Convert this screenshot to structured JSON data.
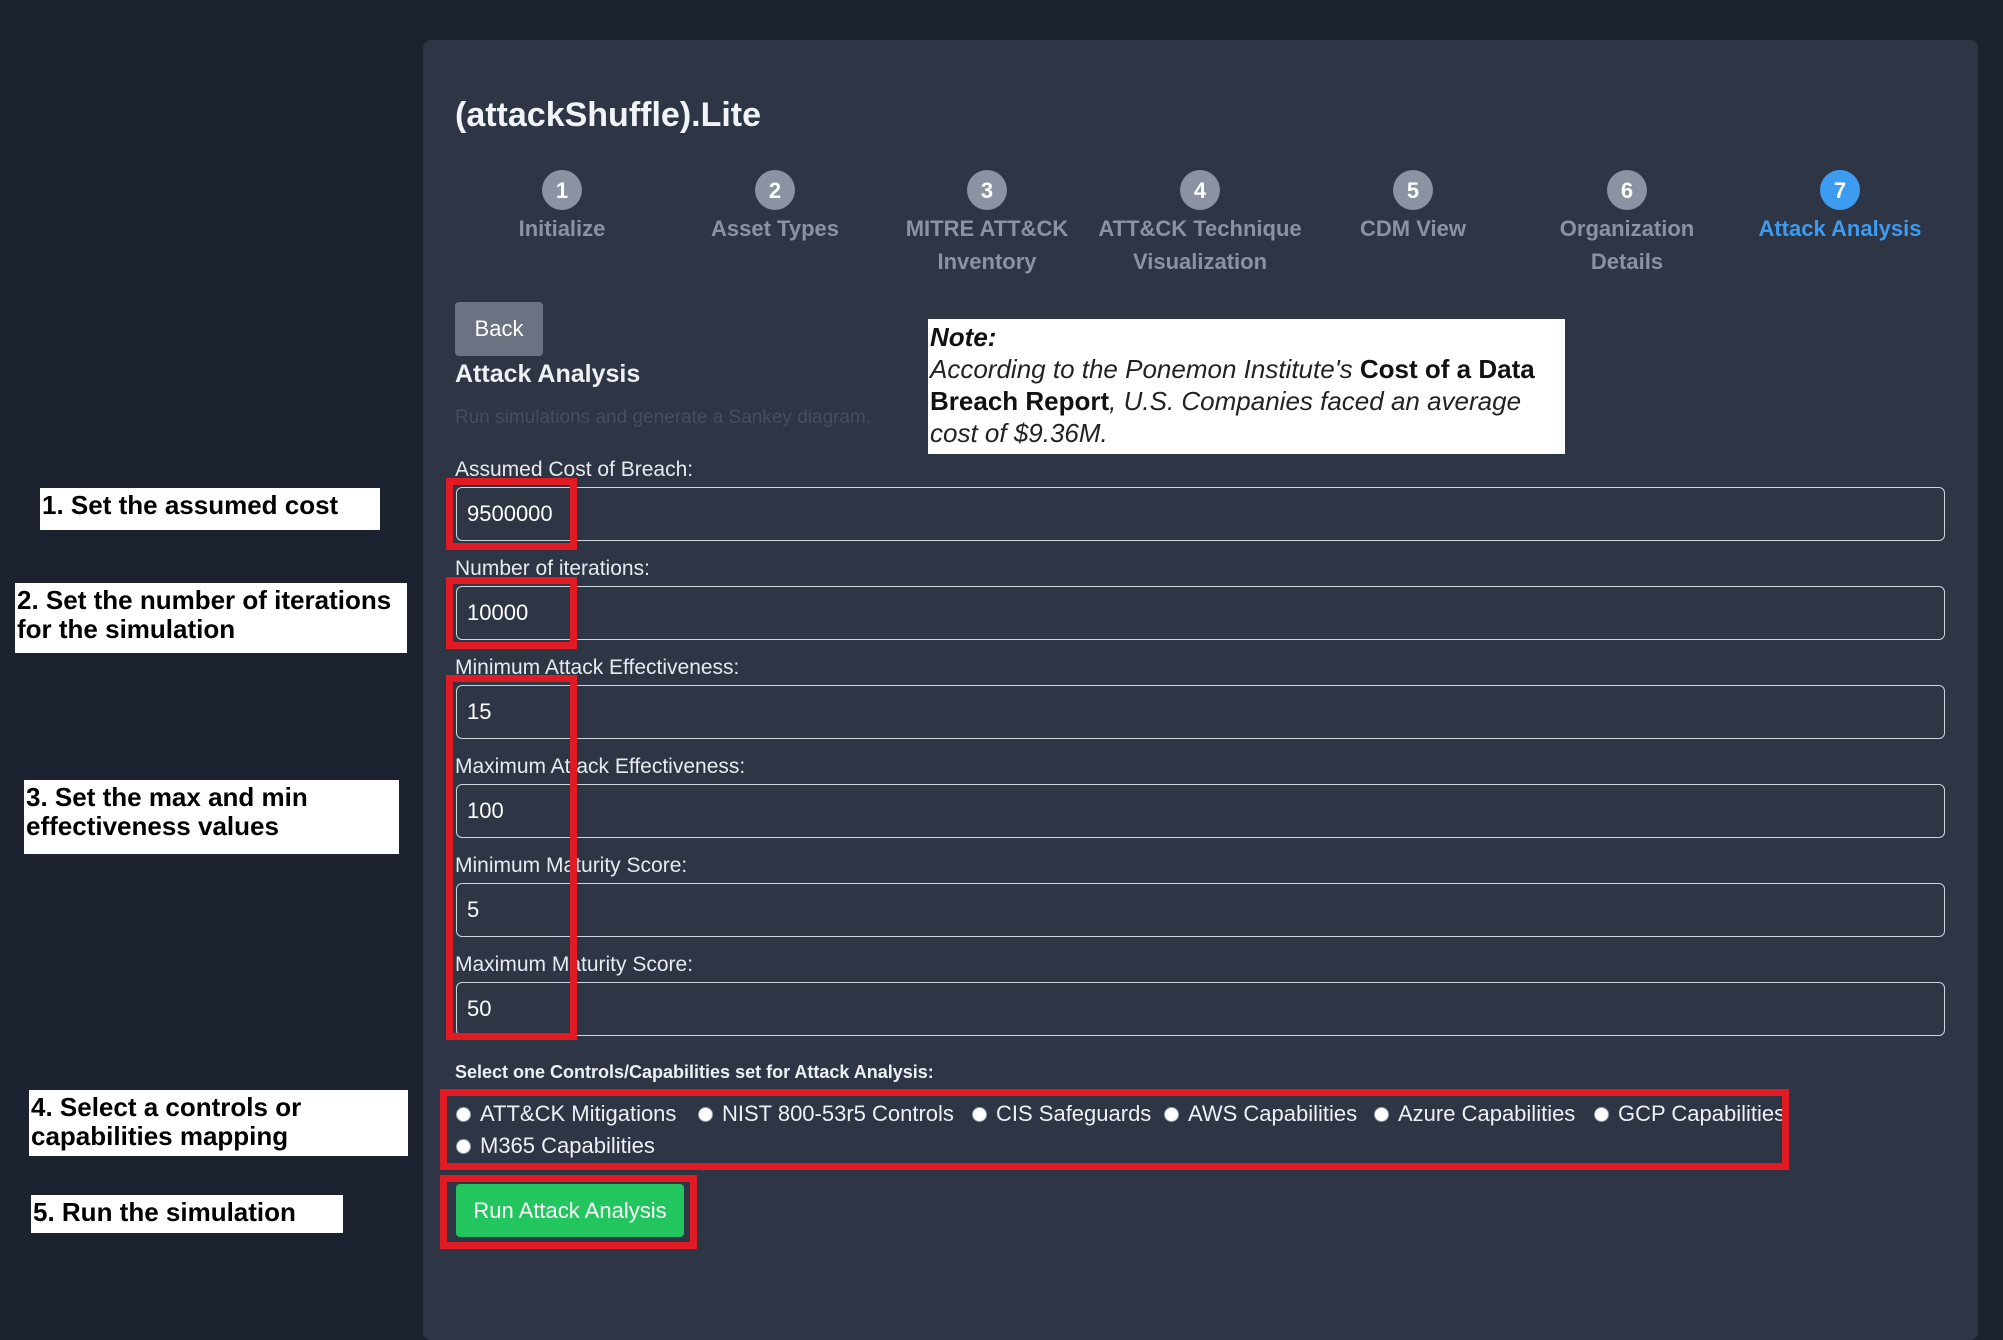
{
  "app": {
    "title": "(attackShuffle).Lite"
  },
  "steps": [
    {
      "num": "1",
      "label": "Initialize"
    },
    {
      "num": "2",
      "label": "Asset Types"
    },
    {
      "num": "3",
      "label": "MITRE ATT&CK Inventory"
    },
    {
      "num": "4",
      "label": "ATT&CK Technique Visualization"
    },
    {
      "num": "5",
      "label": "CDM View"
    },
    {
      "num": "6",
      "label": "Organization Details"
    },
    {
      "num": "7",
      "label": "Attack Analysis"
    }
  ],
  "active_step": 7,
  "back_label": "Back",
  "section": {
    "title": "Attack Analysis",
    "subtitle": "Run simulations and generate a Sankey diagram."
  },
  "note": {
    "heading": "Note:",
    "text_before": "According to the Ponemon Institute's ",
    "bold": "Cost of a Data Breach Report",
    "text_after": ", U.S. Companies faced an average cost of $9.36M."
  },
  "fields": [
    {
      "label": "Assumed Cost of Breach:",
      "value": "9500000"
    },
    {
      "label": "Number of iterations:",
      "value": "10000"
    },
    {
      "label": "Minimum Attack Effectiveness:",
      "value": "15"
    },
    {
      "label": "Maximum Attack Effectiveness:",
      "value": "100"
    },
    {
      "label": "Minimum Maturity Score:",
      "value": "5"
    },
    {
      "label": "Maximum Maturity Score:",
      "value": "50"
    }
  ],
  "controls": {
    "title": "Select one Controls/Capabilities set for Attack Analysis:",
    "options": [
      "ATT&CK Mitigations",
      "NIST 800-53r5 Controls",
      "CIS Safeguards",
      "AWS Capabilities",
      "Azure Capabilities",
      "GCP Capabilities",
      "M365 Capabilities"
    ]
  },
  "run_label": "Run Attack Analysis",
  "callouts": [
    "1. Set the assumed cost",
    "2. Set the number of iterations for the simulation",
    "3. Set the max and min effectiveness values",
    "4. Select a controls or capabilities mapping",
    "5. Run the simulation"
  ],
  "colors": {
    "background": "#1c2230",
    "card": "#2e3545",
    "active_step": "#3d9bf0",
    "run_button": "#22c55e",
    "annotation_red": "#e01b24"
  }
}
